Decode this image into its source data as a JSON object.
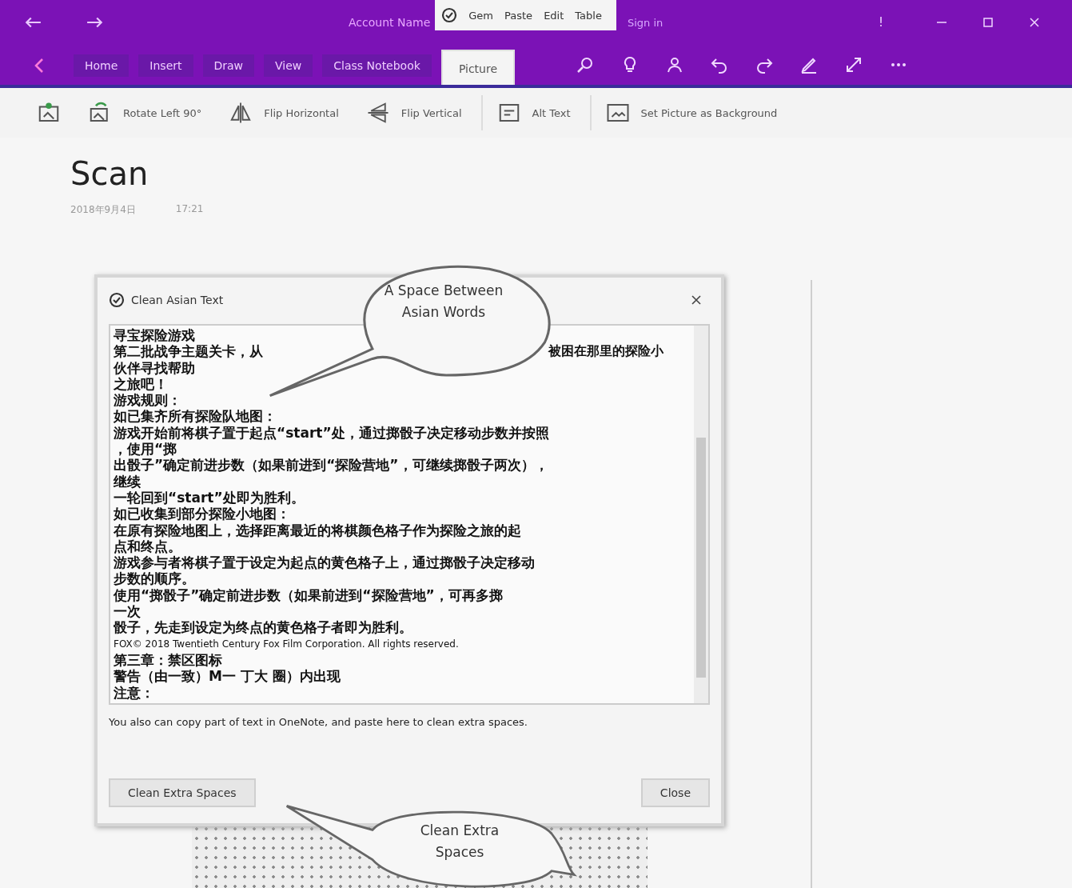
{
  "title_bar": {
    "account": "Account Name",
    "addin_menu": [
      "Gem",
      "Paste",
      "Edit",
      "Table"
    ],
    "sign_in": "Sign in",
    "feedback": "!"
  },
  "ribbon": {
    "tabs": [
      {
        "label": "Home",
        "selected": false
      },
      {
        "label": "Insert",
        "selected": false
      },
      {
        "label": "Draw",
        "selected": false
      },
      {
        "label": "View",
        "selected": false
      },
      {
        "label": "Class Notebook",
        "selected": false
      },
      {
        "label": "Picture",
        "selected": true
      }
    ]
  },
  "picture_toolbar": [
    {
      "kind": "reset"
    },
    {
      "kind": "rotate",
      "label": "Rotate Left 90°"
    },
    {
      "kind": "flip-h",
      "label": "Flip Horizontal"
    },
    {
      "kind": "flip-v",
      "label": "Flip Vertical"
    },
    {
      "kind": "alt",
      "label": "Alt Text"
    },
    {
      "kind": "background",
      "label": "Set Picture as Background"
    }
  ],
  "page": {
    "title": "Scan",
    "date": "2018年9月4日",
    "time": "17:21"
  },
  "dialog": {
    "title": "Clean Asian Text",
    "text_lines": [
      "寻宝探险游戏",
      "第二批战争主题关卡，从",
      "伙伴寻找帮助",
      "之旅吧！",
      "游戏规则：",
      "如已集齐所有探险队地图：",
      "游戏开始前将棋子置于起点“start”处，通过掷骰子决定移动步数并按照",
      "，使用“掷",
      "出骰子”确定前进步数（如果前进到“探险营地”，可继续掷骰子两次），",
      "继续",
      "一轮回到“start”处即为胜利。",
      "如已收集到部分探险小地图：",
      "在原有探险地图上，选择距离最近的将棋颜色格子作为探险之旅的起",
      "点和终点。",
      "游戏参与者将棋子置于设定为起点的黄色格子上，通过掷骰子决定移动",
      "步数的顺序。",
      "使用“掷骰子”确定前进步数（如果前进到“探险营地”，可再多掷",
      "一次",
      "骰子，先走到设定为终点的黄色格子者即为胜利。",
      "FOX© 2018 Twentieth Century Fox Film Corporation. All rights reserved.",
      "第三章：禁区图标",
      "警告（由一致）M一 丁大 圈）内出现",
      "注意："
    ],
    "side_text": "被困在那里的探险小",
    "hint": "You also can copy part of text in OneNote, and paste here to clean extra spaces.",
    "clean_button": "Clean Extra Spaces",
    "close_button": "Close"
  },
  "callouts": [
    {
      "text": "A Space Between Asian Words"
    },
    {
      "text": "Clean Extra Spaces"
    }
  ]
}
